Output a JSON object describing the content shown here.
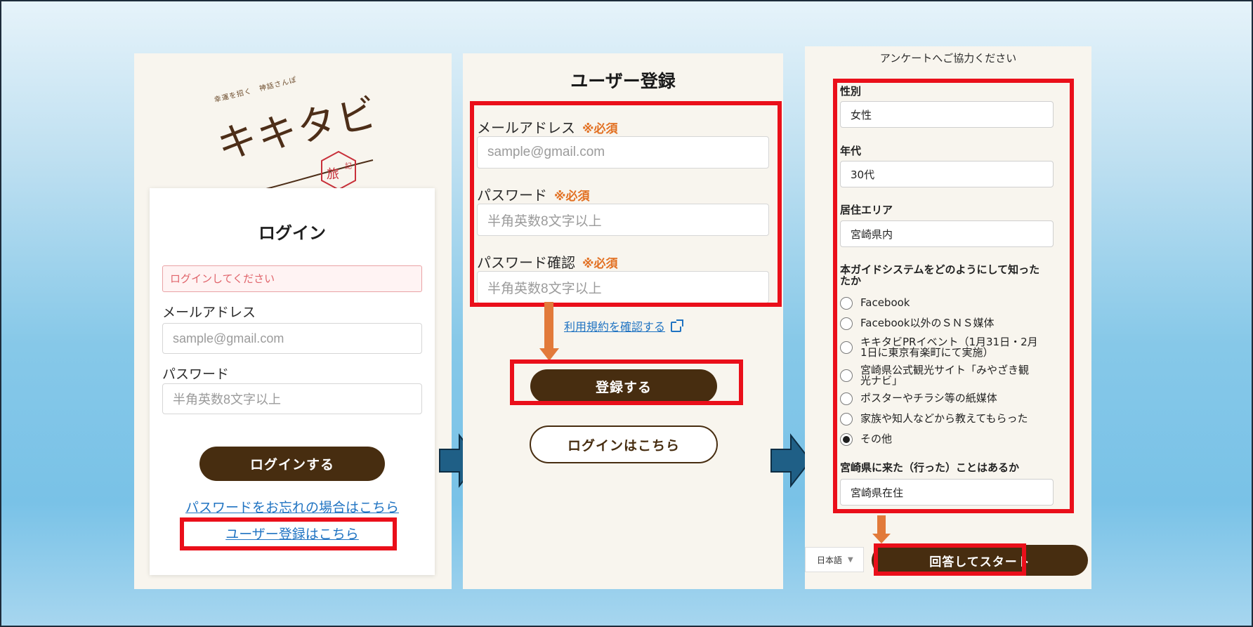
{
  "login": {
    "logo_tagline": "幸運を招く　神話さんぽ",
    "logo_name": "キキタビ",
    "logo_seal": "旅",
    "logo_seal_small": "記",
    "title": "ログイン",
    "alert": "ログインしてください",
    "email_label": "メールアドレス",
    "email_placeholder": "sample@gmail.com",
    "password_label": "パスワード",
    "password_placeholder": "半角英数8文字以上",
    "submit": "ログインする",
    "forgot_link": "パスワードをお忘れの場合はこちら",
    "register_link": "ユーザー登録はこちら"
  },
  "register": {
    "title": "ユーザー登録",
    "required_mark": "※必須",
    "email_label": "メールアドレス",
    "email_placeholder": "sample@gmail.com",
    "password_label": "パスワード",
    "password_placeholder": "半角英数8文字以上",
    "password_confirm_label": "パスワード確認",
    "password_confirm_placeholder": "半角英数8文字以上",
    "terms_link": "利用規約を確認する",
    "submit": "登録する",
    "login_link": "ログインはこちら"
  },
  "survey": {
    "header": "アンケートへご協力ください",
    "gender_label": "性別",
    "gender_value": "女性",
    "age_label": "年代",
    "age_value": "30代",
    "area_label": "居住エリア",
    "area_value": "宮崎県内",
    "source_label_1": "本ガイドシステムをどのようにして知った",
    "source_label_2": "たか",
    "options": [
      {
        "line1": "Facebook",
        "line2": ""
      },
      {
        "line1": "Facebook以外のＳＮＳ媒体",
        "line2": ""
      },
      {
        "line1": "キキタビPRイベント（1月31日・2月",
        "line2": "1日に東京有楽町にて実施）"
      },
      {
        "line1": "宮崎県公式観光サイト「みやざき観",
        "line2": "光ナビ」"
      },
      {
        "line1": "ポスターやチラシ等の紙媒体",
        "line2": ""
      },
      {
        "line1": "家族や知人などから教えてもらった",
        "line2": ""
      },
      {
        "line1": "その他",
        "line2": ""
      }
    ],
    "selected_option_index": 6,
    "visited_label": "宮崎県に来た（行った）ことはあるか",
    "visited_value": "宮崎県在住",
    "language": "日本語",
    "submit": "回答してスタート"
  },
  "colors": {
    "highlight_red": "#ea0f1a",
    "brown": "#472d10",
    "orange": "#e27022",
    "flow_arrow": "#1f5f86",
    "link_blue": "#1f73c2"
  }
}
